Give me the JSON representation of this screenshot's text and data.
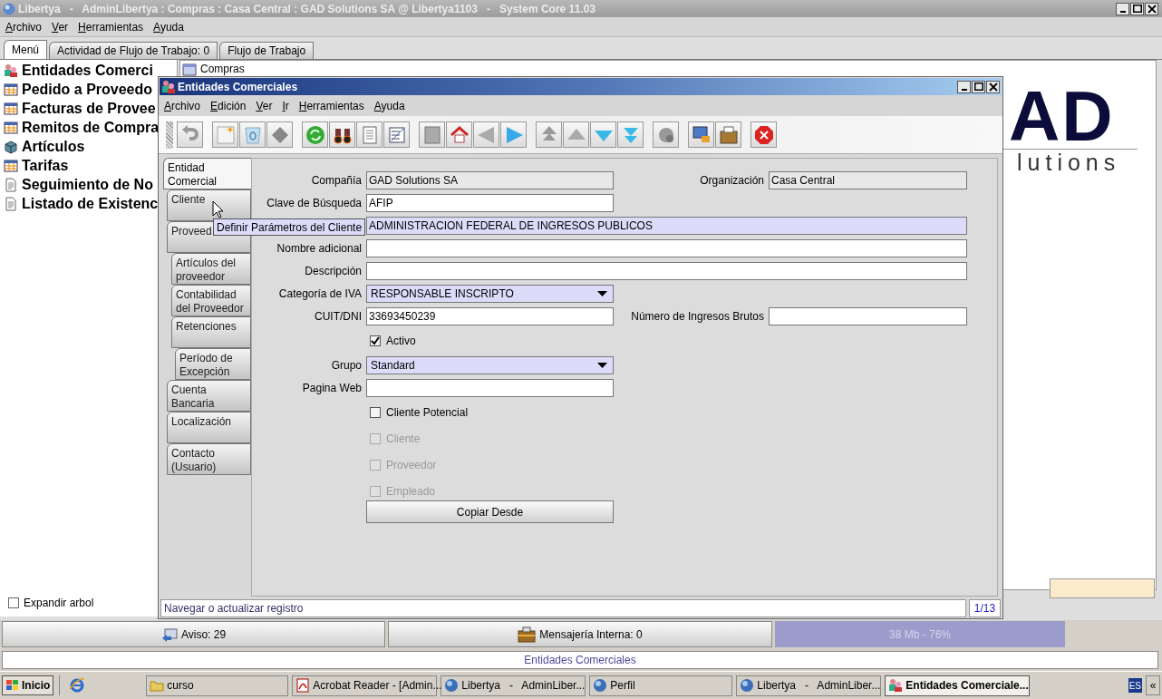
{
  "window": {
    "title": "Libertya   -   AdminLibertya : Compras : Casa Central : GAD Solutions SA @ Libertya1103   -   System Core 11.03"
  },
  "menu": [
    "Archivo",
    "Ver",
    "Herramientas",
    "Ayuda"
  ],
  "tabs": [
    {
      "label": "Menú",
      "selected": true
    },
    {
      "label": "Actividad de Flujo de Trabajo: 0",
      "selected": false
    },
    {
      "label": "Flujo de Trabajo",
      "selected": false
    }
  ],
  "favorites": [
    {
      "label": "Entidades Comerci",
      "kind": "entity"
    },
    {
      "label": "Pedido a Proveedo",
      "kind": "window"
    },
    {
      "label": "Facturas de Provee",
      "kind": "window"
    },
    {
      "label": "Remitos de Compra",
      "kind": "window"
    },
    {
      "label": "Artículos",
      "kind": "product"
    },
    {
      "label": "Tarifas",
      "kind": "window"
    },
    {
      "label": "Seguimiento de No",
      "kind": "report"
    },
    {
      "label": "Listado de Existenc",
      "kind": "report"
    }
  ],
  "expand_tree": {
    "label": "Expandir arbol",
    "checked": false
  },
  "tree": {
    "root": "Compras"
  },
  "logo": {
    "line_1": "AD",
    "line_2": "lutions"
  },
  "dialog": {
    "title": "Entidades Comerciales",
    "menu": [
      "Archivo",
      "Edición",
      "Ver",
      "Ir",
      "Herramientas",
      "Ayuda"
    ],
    "tabs": [
      {
        "label": "Entidad Comercial",
        "selected": true
      },
      {
        "label": "Cliente",
        "selected": false
      },
      {
        "label": "Proveed",
        "selected": false,
        "children": [
          {
            "label": "Artículos del proveedor",
            "selected": false
          },
          {
            "label": "Contabilidad del Proveedor",
            "selected": false
          },
          {
            "label": "Retenciones",
            "selected": false,
            "children": [
              {
                "label": "Período de Excepción",
                "selected": false
              }
            ]
          }
        ]
      },
      {
        "label": "Cuenta Bancaria",
        "selected": false
      },
      {
        "label": "Localización",
        "selected": false
      },
      {
        "label": "Contacto (Usuario)",
        "selected": false
      }
    ],
    "fields": [
      {
        "kind": "text",
        "label": "Compañía",
        "value": "GAD Solutions SA",
        "readonly": true,
        "right": {
          "label": "Organización",
          "value": "Casa Central",
          "readonly": true
        }
      },
      {
        "kind": "text",
        "label": "Clave de Búsqueda",
        "value": "AFIP",
        "readonly": false
      },
      {
        "kind": "wide",
        "value": "ADMINISTRACION FEDERAL DE INGRESOS PUBLICOS",
        "mandatory": true
      },
      {
        "kind": "wide",
        "label": "Nombre adicional",
        "mandatory": false
      },
      {
        "kind": "wide",
        "label": "Descripción",
        "mandatory": false
      },
      {
        "kind": "select",
        "label": "Categoría de IVA",
        "value": "RESPONSABLE INSCRIPTO"
      },
      {
        "kind": "text",
        "label": "CUIT/DNI",
        "value": "33693450239",
        "readonly": false,
        "right": {
          "label": "Número de Ingresos Brutos",
          "readonly": false
        }
      },
      {
        "kind": "checkbox",
        "label": "Activo",
        "checked": true,
        "disabled": false
      },
      {
        "kind": "select",
        "label": "Grupo",
        "value": "Standard"
      },
      {
        "kind": "text",
        "label": "Pagina Web",
        "readonly": false
      },
      {
        "kind": "checkbox",
        "label": "Cliente Potencial",
        "checked": false,
        "disabled": false
      },
      {
        "kind": "checkbox",
        "label": "Cliente",
        "checked": false,
        "disabled": true
      },
      {
        "kind": "checkbox",
        "label": "Proveedor",
        "checked": false,
        "disabled": true
      },
      {
        "kind": "checkbox",
        "label": "Empleado",
        "checked": false,
        "disabled": true
      },
      {
        "kind": "button",
        "label": "Copiar Desde"
      }
    ],
    "tooltip": "Definir Parámetros del Cliente",
    "status": "Navegar o actualizar registro",
    "record": "1/13"
  },
  "status_bar": {
    "alerts": "Aviso: 29",
    "messages": "Mensajería Interna: 0",
    "memory": "38 Mb - 76%",
    "window_name": "Entidades Comerciales"
  },
  "taskbar": {
    "start": "Inicio",
    "items": [
      {
        "label": "curso",
        "kind": "folder",
        "selected": false
      },
      {
        "label": "Acrobat Reader - [Admin...",
        "kind": "pdf",
        "selected": false
      },
      {
        "label": "Libertya   -   AdminLiber...",
        "kind": "app",
        "selected": false
      },
      {
        "label": "Perfil",
        "kind": "app",
        "selected": false
      },
      {
        "label": "Libertya   -   AdminLiber...",
        "kind": "app",
        "selected": false
      },
      {
        "label": "Entidades Comerciale...",
        "kind": "entity",
        "selected": true
      }
    ],
    "language": "ES",
    "expand": "«"
  }
}
